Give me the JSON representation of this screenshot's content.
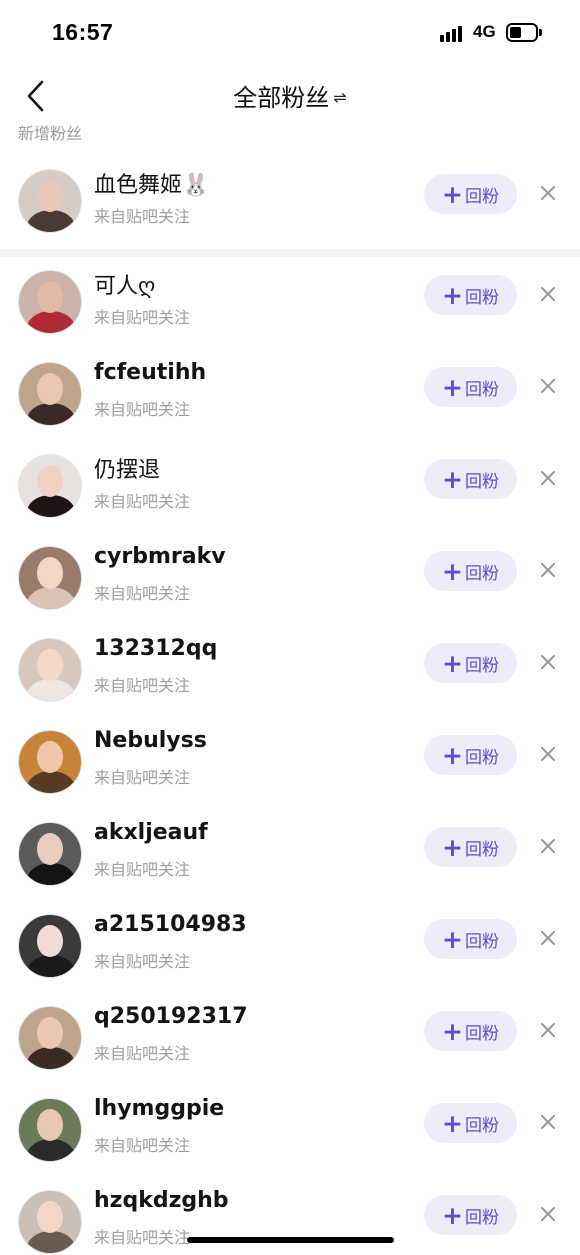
{
  "status_bar": {
    "time": "16:57",
    "network": "4G",
    "battery_level": 0.45,
    "signal_icon": "signal-bars-icon"
  },
  "nav": {
    "title": "全部粉丝",
    "switch_icon": "⇌",
    "back_icon": "chevron-left-icon"
  },
  "section": {
    "new_followers_label": "新增粉丝"
  },
  "colors": {
    "accent": "#5b4fd0",
    "button_bg": "#eeebfb",
    "subtext": "#a0a0a0"
  },
  "followers": [
    {
      "name": "血色舞姬🐰",
      "source": "来自贴吧关注",
      "action": "回粉",
      "cjk": true,
      "face": "#e8c8b8",
      "body": "#4a3a34",
      "bg": "#d6ccc6"
    },
    {
      "name": "可人ღ",
      "source": "来自贴吧关注",
      "action": "回粉",
      "cjk": true,
      "face": "#e2b9a4",
      "body": "#b02a35",
      "bg": "#c9b3aa"
    },
    {
      "name": "fcfeutihh",
      "source": "来自贴吧关注",
      "action": "回粉",
      "cjk": false,
      "face": "#eac8b0",
      "body": "#3a2a24",
      "bg": "#bfa48c"
    },
    {
      "name": "仍摆退",
      "source": "来自贴吧关注",
      "action": "回粉",
      "cjk": true,
      "face": "#f0d2c2",
      "body": "#1e1616",
      "bg": "#e8e2de"
    },
    {
      "name": "cyrbmrakv",
      "source": "来自贴吧关注",
      "action": "回粉",
      "cjk": false,
      "face": "#f2d6c6",
      "body": "#d9c2b6",
      "bg": "#9a7a6a"
    },
    {
      "name": "132312qq",
      "source": "来自贴吧关注",
      "action": "回粉",
      "cjk": false,
      "face": "#f4d8c8",
      "body": "#efe6e0",
      "bg": "#d8c8bc"
    },
    {
      "name": "Nebulyss",
      "source": "来自贴吧关注",
      "action": "回粉",
      "cjk": false,
      "face": "#f0c8a8",
      "body": "#5a3a22",
      "bg": "#c8843a"
    },
    {
      "name": "akxljeauf",
      "source": "来自贴吧关注",
      "action": "回粉",
      "cjk": false,
      "face": "#e8ccc0",
      "body": "#141414",
      "bg": "#5a5a5a"
    },
    {
      "name": "a215104983",
      "source": "来自贴吧关注",
      "action": "回粉",
      "cjk": false,
      "face": "#efdcd6",
      "body": "#1a1a1a",
      "bg": "#3a3a3a"
    },
    {
      "name": "q250192317",
      "source": "来自贴吧关注",
      "action": "回粉",
      "cjk": false,
      "face": "#eac8b0",
      "body": "#3a2a24",
      "bg": "#bfa48c"
    },
    {
      "name": "lhymggpie",
      "source": "来自贴吧关注",
      "action": "回粉",
      "cjk": false,
      "face": "#e6c8b4",
      "body": "#2a2a2a",
      "bg": "#6a7a5a"
    },
    {
      "name": "hzqkdzghb",
      "source": "来自贴吧关注",
      "action": "回粉",
      "cjk": false,
      "face": "#f2d6c8",
      "body": "#6a5a50",
      "bg": "#cbbfb6"
    }
  ]
}
